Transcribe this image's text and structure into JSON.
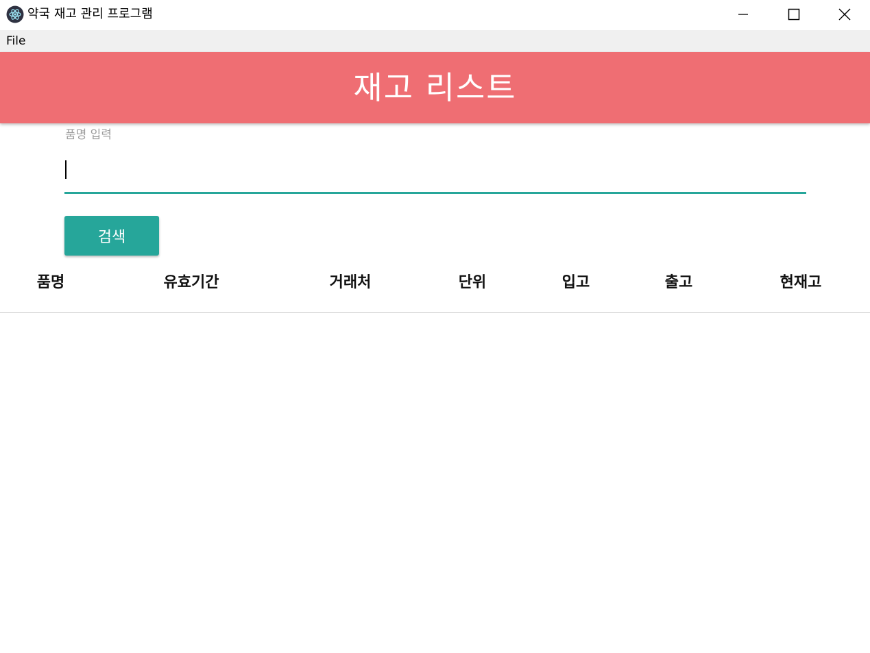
{
  "window": {
    "title": "약국 재고 관리 프로그램",
    "icon": "electron-atom-icon"
  },
  "menu": {
    "items": [
      "File"
    ]
  },
  "header": {
    "title": "재고 리스트",
    "background_color": "#ef6e73"
  },
  "search": {
    "label": "품명 입력",
    "value": "",
    "button_label": "검색",
    "accent_color": "#26a69a"
  },
  "table": {
    "columns": [
      "품명",
      "유효기간",
      "거래처",
      "단위",
      "입고",
      "출고",
      "현재고"
    ],
    "rows": []
  }
}
